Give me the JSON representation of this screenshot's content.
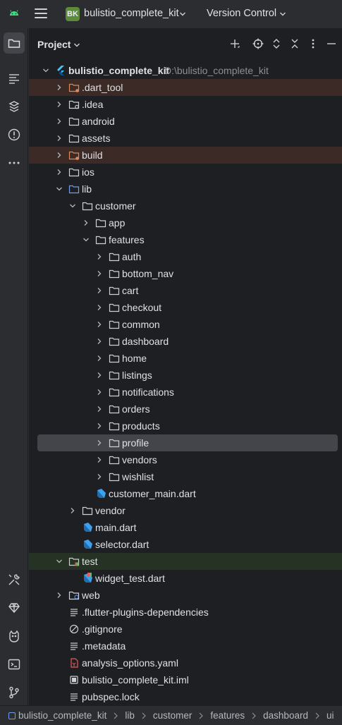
{
  "titlebar": {
    "project_badge": "BK",
    "project_name": "bulistio_complete_kit",
    "vcs_label": "Version Control"
  },
  "colors": {
    "accent_blue": "#3574f0",
    "folder_stroke": "#ced0d6",
    "excluded_folder": "#e08855",
    "flutter_blue": "#3fa1eb",
    "excluded_row_bg": "#3b2a26",
    "test_row_bg": "#263223",
    "selected_row_bg": "#43454a",
    "badge_green": "#5e8a3c"
  },
  "panel": {
    "title": "Project"
  },
  "tree": [
    {
      "label": "bulistio_complete_kit",
      "path": "D:\\bulistio_complete_kit",
      "depth": 0,
      "icon": "flutter-icon",
      "expanded": true,
      "bold": true
    },
    {
      "label": ".dart_tool",
      "depth": 1,
      "icon": "folder-excluded-icon",
      "expanded": false,
      "state": "excluded"
    },
    {
      "label": ".idea",
      "depth": 1,
      "icon": "folder-config-icon",
      "expanded": false
    },
    {
      "label": "android",
      "depth": 1,
      "icon": "folder-icon",
      "expanded": false
    },
    {
      "label": "assets",
      "depth": 1,
      "icon": "folder-icon",
      "expanded": false
    },
    {
      "label": "build",
      "depth": 1,
      "icon": "folder-excluded-icon",
      "expanded": false,
      "state": "excluded"
    },
    {
      "label": "ios",
      "depth": 1,
      "icon": "folder-icon",
      "expanded": false
    },
    {
      "label": "lib",
      "depth": 1,
      "icon": "folder-source-icon",
      "expanded": true
    },
    {
      "label": "customer",
      "depth": 2,
      "icon": "folder-icon",
      "expanded": true
    },
    {
      "label": "app",
      "depth": 3,
      "icon": "folder-icon",
      "expanded": false
    },
    {
      "label": "features",
      "depth": 3,
      "icon": "folder-icon",
      "expanded": true
    },
    {
      "label": "auth",
      "depth": 4,
      "icon": "folder-icon",
      "expanded": false
    },
    {
      "label": "bottom_nav",
      "depth": 4,
      "icon": "folder-icon",
      "expanded": false
    },
    {
      "label": "cart",
      "depth": 4,
      "icon": "folder-icon",
      "expanded": false
    },
    {
      "label": "checkout",
      "depth": 4,
      "icon": "folder-icon",
      "expanded": false
    },
    {
      "label": "common",
      "depth": 4,
      "icon": "folder-icon",
      "expanded": false
    },
    {
      "label": "dashboard",
      "depth": 4,
      "icon": "folder-icon",
      "expanded": false
    },
    {
      "label": "home",
      "depth": 4,
      "icon": "folder-icon",
      "expanded": false
    },
    {
      "label": "listings",
      "depth": 4,
      "icon": "folder-icon",
      "expanded": false
    },
    {
      "label": "notifications",
      "depth": 4,
      "icon": "folder-icon",
      "expanded": false
    },
    {
      "label": "orders",
      "depth": 4,
      "icon": "folder-icon",
      "expanded": false
    },
    {
      "label": "products",
      "depth": 4,
      "icon": "folder-icon",
      "expanded": false
    },
    {
      "label": "profile",
      "depth": 4,
      "icon": "folder-icon",
      "expanded": false,
      "state": "selected"
    },
    {
      "label": "vendors",
      "depth": 4,
      "icon": "folder-icon",
      "expanded": false
    },
    {
      "label": "wishlist",
      "depth": 4,
      "icon": "folder-icon",
      "expanded": false
    },
    {
      "label": "customer_main.dart",
      "depth": 3,
      "icon": "dart-file-icon",
      "leaf": true
    },
    {
      "label": "vendor",
      "depth": 2,
      "icon": "folder-icon",
      "expanded": false
    },
    {
      "label": "main.dart",
      "depth": 2,
      "icon": "dart-file-icon",
      "leaf": true
    },
    {
      "label": "selector.dart",
      "depth": 2,
      "icon": "dart-file-icon",
      "leaf": true
    },
    {
      "label": "test",
      "depth": 1,
      "icon": "folder-test-icon",
      "expanded": true,
      "state": "test"
    },
    {
      "label": "widget_test.dart",
      "depth": 2,
      "icon": "dart-test-file-icon",
      "leaf": true
    },
    {
      "label": "web",
      "depth": 1,
      "icon": "folder-web-icon",
      "expanded": false
    },
    {
      "label": ".flutter-plugins-dependencies",
      "depth": 1,
      "icon": "text-file-icon",
      "leaf": true
    },
    {
      "label": ".gitignore",
      "depth": 1,
      "icon": "ignore-file-icon",
      "leaf": true
    },
    {
      "label": ".metadata",
      "depth": 1,
      "icon": "text-file-icon",
      "leaf": true
    },
    {
      "label": "analysis_options.yaml",
      "depth": 1,
      "icon": "yaml-file-icon",
      "leaf": true
    },
    {
      "label": "bulistio_complete_kit.iml",
      "depth": 1,
      "icon": "module-file-icon",
      "leaf": true
    },
    {
      "label": "pubspec.lock",
      "depth": 1,
      "icon": "text-file-icon",
      "leaf": true
    }
  ],
  "breadcrumb": [
    "bulistio_complete_kit",
    "lib",
    "customer",
    "features",
    "dashboard",
    "ui"
  ]
}
